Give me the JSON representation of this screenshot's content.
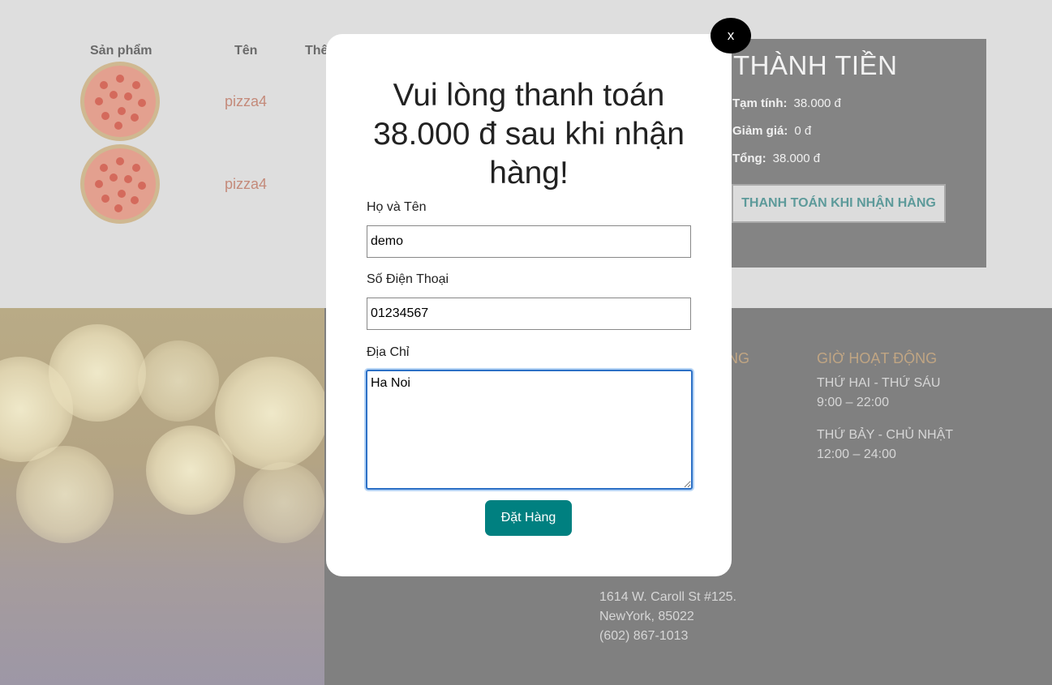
{
  "cart": {
    "columns": [
      "Sản phẩm",
      "Tên",
      "Thê"
    ],
    "items": [
      {
        "name": "pizza4"
      },
      {
        "name": "pizza4"
      }
    ]
  },
  "summary": {
    "title": "THÀNH TIỀN",
    "subtotal_label": "Tạm tính:",
    "subtotal_value": "38.000 đ",
    "discount_label": "Giảm giá:",
    "discount_value": "0 đ",
    "total_label": "Tổng:",
    "total_value": "38.000 đ",
    "cod_button": "THANH TOÁN KHI NHẬN HÀNG"
  },
  "footer": {
    "hours_heading": "GIỜ HOẠT ĐỘNG",
    "hidden_heading_fragment": "NG",
    "weekday_label": "THỨ HAI - THỨ SÁU",
    "weekday_hours": "9:00 – 22:00",
    "weekend_label": "THỨ BẢY - CHỦ NHẬT",
    "weekend_hours": "12:00 – 24:00",
    "address_line1": "1614 W. Caroll St #125.",
    "address_line2": "NewYork, 85022",
    "phone": "(602) 867-1013"
  },
  "modal": {
    "close_label": "x",
    "title": "Vui lòng thanh toán 38.000 đ sau khi nhận hàng!",
    "name_label": "Họ và Tên",
    "name_value": "demo",
    "phone_label": "Số Điện Thoại",
    "phone_value": "01234567",
    "address_label": "Địa Chỉ",
    "address_value": "Ha Noi",
    "submit_label": "Đặt Hàng"
  },
  "colors": {
    "accent": "#008080",
    "overlay_background": "#dedede",
    "summary_panel": "#848484",
    "footer_heading": "#c0a583"
  }
}
